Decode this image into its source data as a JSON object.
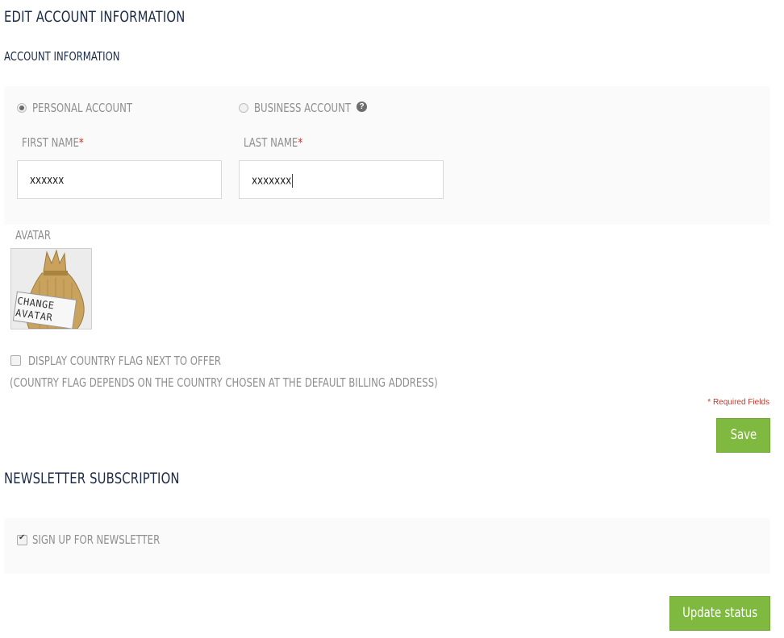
{
  "page": {
    "title": "EDIT ACCOUNT INFORMATION",
    "section_account": "ACCOUNT INFORMATION",
    "section_newsletter": "NEWSLETTER SUBSCRIPTION"
  },
  "account_type": {
    "personal_label": "PERSONAL ACCOUNT",
    "business_label": "BUSINESS ACCOUNT",
    "selected": "personal",
    "help_symbol": "?"
  },
  "fields": {
    "first_name": {
      "label": "FIRST NAME",
      "required_mark": "*",
      "value": "xxxxxx"
    },
    "last_name": {
      "label": "LAST NAME",
      "required_mark": "*",
      "value": "xxxxxxx"
    }
  },
  "avatar": {
    "label": "AVATAR",
    "image_text": "CHANGE AVATAR"
  },
  "country_flag": {
    "label": "DISPLAY COUNTRY FLAG NEXT TO OFFER",
    "note": "(COUNTRY FLAG DEPENDS ON THE COUNTRY CHOSEN AT THE DEFAULT BILLING ADDRESS)",
    "checked": false
  },
  "required_note": "* Required Fields",
  "save_button": "Save",
  "newsletter": {
    "label": "SIGN UP FOR NEWSLETTER",
    "checked": true
  },
  "update_button": "Update status",
  "colors": {
    "accent_green": "#80b93f",
    "heading": "#1c2b45",
    "required_red": "#c0392b",
    "label_gray": "#8f8f8f"
  },
  "icons": [
    "question-help-icon",
    "change-avatar-image"
  ]
}
